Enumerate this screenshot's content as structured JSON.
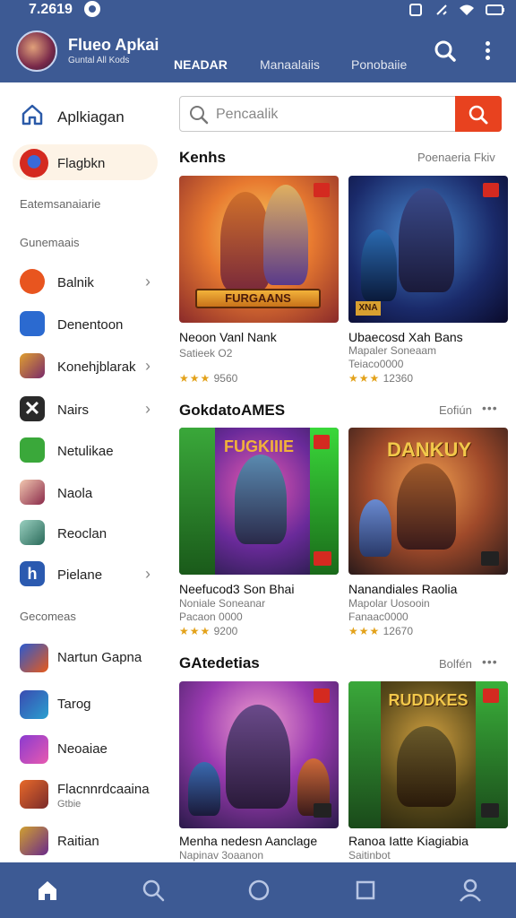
{
  "status_bar": {
    "time": "7.2619"
  },
  "header": {
    "app_title": "Flueo Apkai",
    "app_subtitle": "Guntal All Kods",
    "tabs": [
      {
        "label": "NEADAR",
        "active": true
      },
      {
        "label": "Manaalaiis",
        "active": false
      },
      {
        "label": "Ponobaiie",
        "active": false
      }
    ]
  },
  "sidebar": {
    "home_label": "Aplkiagan",
    "selected_label": "Flagbkn",
    "section_1": "Eatemsanaiarie",
    "section_2": "Gunemaais",
    "items": [
      {
        "label": "Balnik",
        "icon": "red-badge-icon",
        "chevron": true
      },
      {
        "label": "Denentoon",
        "icon": "blue-app-icon",
        "chevron": false
      },
      {
        "label": "Konehjblarak",
        "icon": "game-thumb-icon",
        "chevron": true
      },
      {
        "label": "Nairs",
        "icon": "x-mark-icon",
        "chevron": true
      },
      {
        "label": "Netulikae",
        "icon": "green-app-icon",
        "chevron": false
      },
      {
        "label": "Naola",
        "icon": "game-thumb-icon",
        "chevron": false
      },
      {
        "label": "Reoclan",
        "icon": "game-thumb-icon",
        "chevron": false
      },
      {
        "label": "Pielane",
        "icon": "blue-h-icon",
        "chevron": true
      }
    ],
    "section_3": "Gecomeas",
    "games": [
      {
        "label": "Nartun Gapna",
        "sub": ""
      },
      {
        "label": "Tarog",
        "sub": ""
      },
      {
        "label": "Neoaiae",
        "sub": ""
      },
      {
        "label": "Flacnnrdcaaina",
        "sub": "Gtbie"
      },
      {
        "label": "Raitian",
        "sub": ""
      }
    ]
  },
  "search": {
    "placeholder": "Pencaalik"
  },
  "sections": [
    {
      "title": "Kenhs",
      "link": "Poenaeria Fkiv",
      "dots": false,
      "cards": [
        {
          "title": "Neoon Vanl Nank",
          "sub": "Satieek  O2",
          "extra": "",
          "stars": "★★★",
          "rating": "9560",
          "banner": "FURGAANS",
          "footer_tag": ""
        },
        {
          "title": "Ubaecosd Xah Bans",
          "sub": "Mapaler Soneaam",
          "extra": "Teiaco0000",
          "stars": "★★★",
          "rating": "12360",
          "banner": "",
          "footer_tag": "XNA"
        }
      ]
    },
    {
      "title": "GokdatoAMES",
      "link": "Eofiún",
      "dots": true,
      "cards": [
        {
          "title": "Neefucod3 Son Bhai",
          "sub": "Noniale Soneanar",
          "extra": "Pacaon 0000",
          "stars": "★★★",
          "rating": "9200",
          "banner": "FUGKIIIE",
          "footer_tag": ""
        },
        {
          "title": "Nanandiales Raolia",
          "sub": "Mapolar Uosooin",
          "extra": "Fanaac0000",
          "stars": "★★★",
          "rating": "12670",
          "banner": "DANKUY",
          "footer_tag": ""
        }
      ]
    },
    {
      "title": "GAtedetias",
      "link": "Bolfén",
      "dots": true,
      "cards": [
        {
          "title": "Menha nedesn Aanclage",
          "sub": "Napinav 3oaanon",
          "extra": "",
          "stars": "",
          "rating": "",
          "banner": "",
          "footer_tag": ""
        },
        {
          "title": "Ranoa Iatte Kiagiabia",
          "sub": "Saitinbot",
          "extra": "",
          "stars": "",
          "rating": "",
          "banner": "RUDDKES",
          "footer_tag": ""
        }
      ]
    }
  ],
  "colors": {
    "brand": "#3d5a94",
    "accent": "#e8421f",
    "star": "#e3a21a"
  }
}
